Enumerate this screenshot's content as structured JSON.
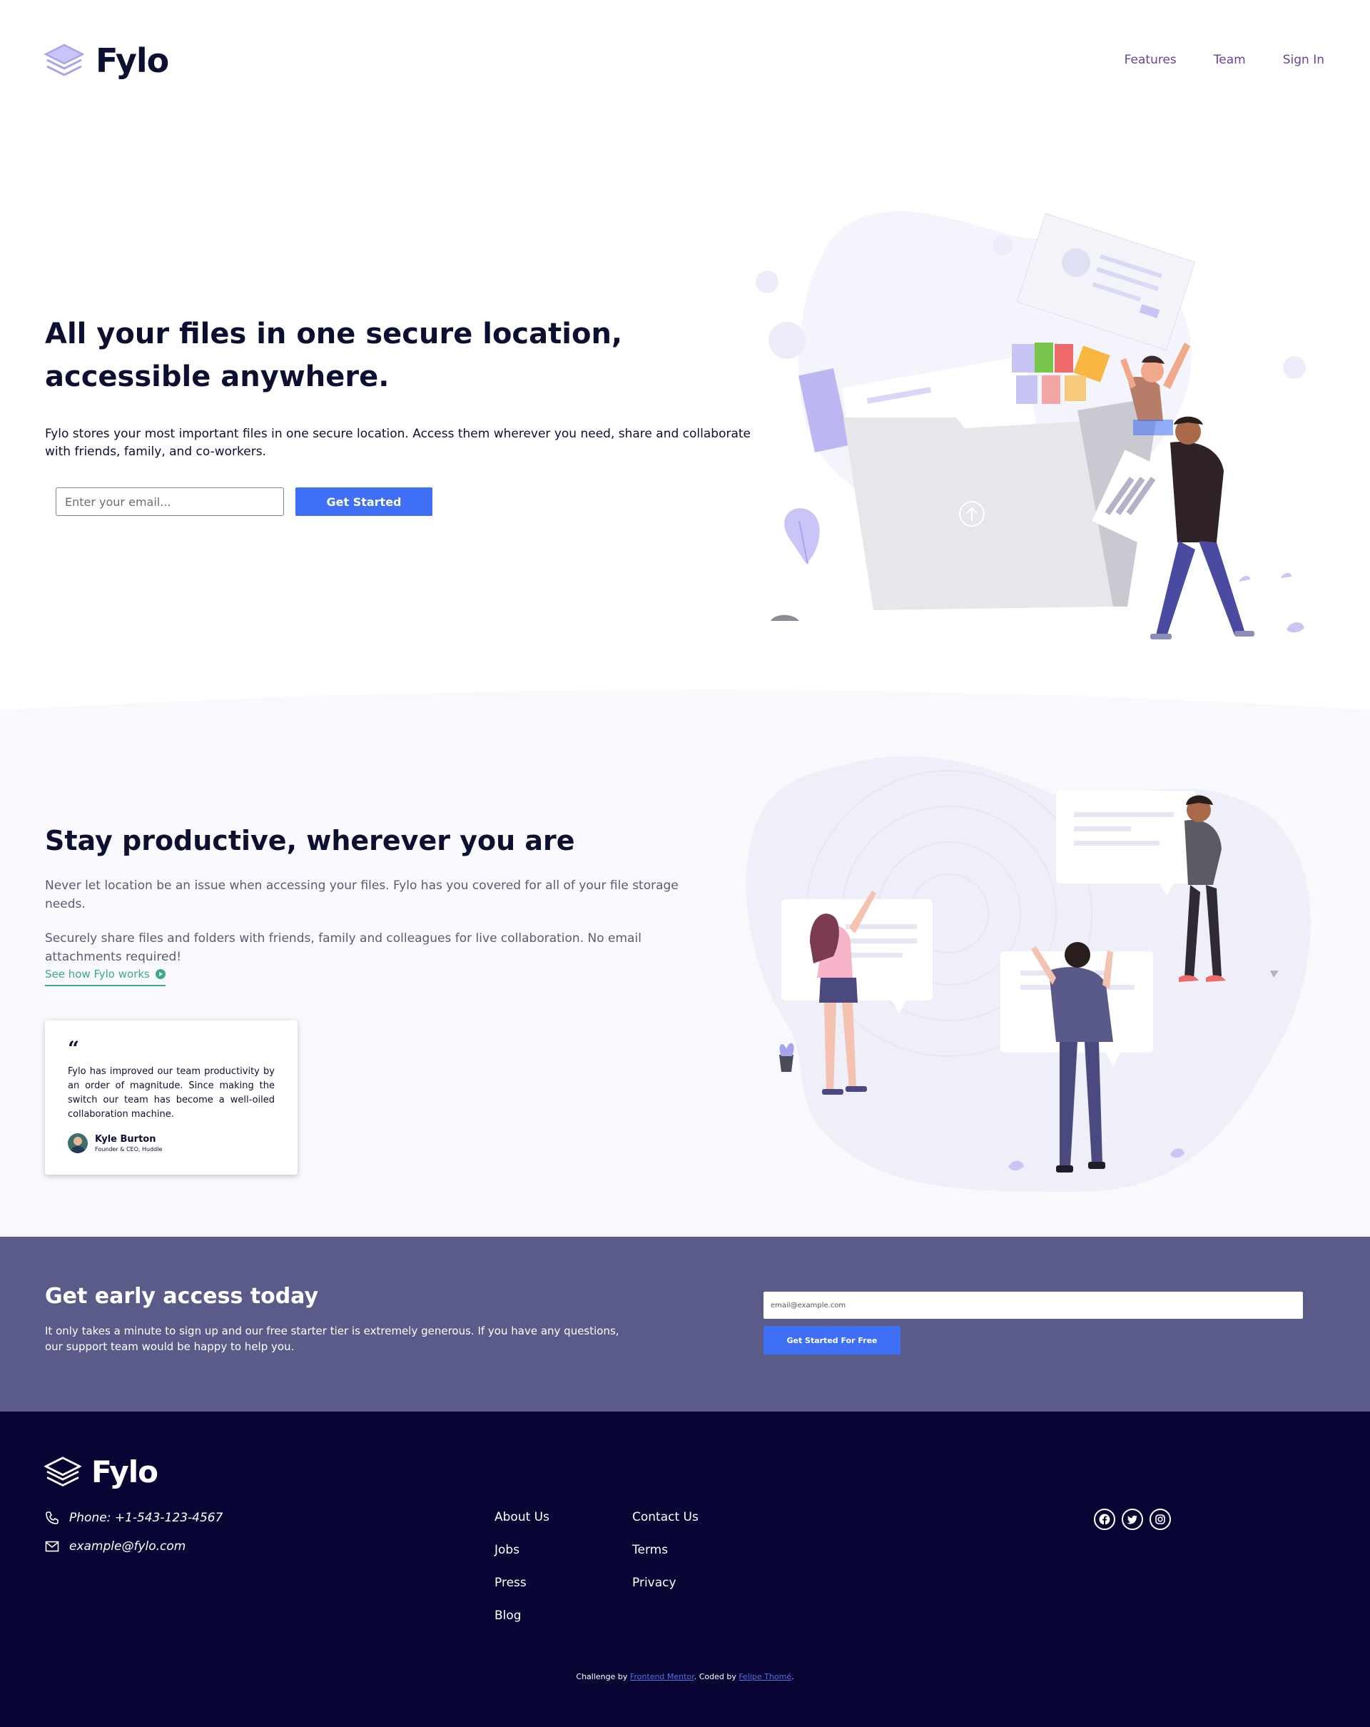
{
  "brand": {
    "name": "Fylo"
  },
  "nav": {
    "links": [
      {
        "label": "Features"
      },
      {
        "label": "Team"
      },
      {
        "label": "Sign In"
      }
    ]
  },
  "hero": {
    "title": "All your files in one secure location, accessible anywhere.",
    "description": "Fylo stores your most important files in one secure location. Access them wherever you need, share and collaborate with friends, family, and co-workers.",
    "email_placeholder": "Enter your email...",
    "cta_label": "Get Started"
  },
  "productive": {
    "title": "Stay productive, wherever you are",
    "paragraph_1": "Never let location be an issue when accessing your files. Fylo has you covered for all of your file storage needs.",
    "paragraph_2": "Securely share files and folders with friends, family and colleagues for live collaboration. No email attachments required!",
    "link_label": "See how Fylo works",
    "testimonial": {
      "quote_mark": "“",
      "text": "Fylo has improved our team productivity by an order of magnitude. Since making the switch our team has become a well-oiled collaboration machine.",
      "name": "Kyle Burton",
      "role": "Founder & CEO, Huddle"
    }
  },
  "early_access": {
    "title": "Get early access today",
    "description": "It only takes a minute to sign up and our free starter tier is extremely generous. If you have any questions, our support team would be happy to help you.",
    "email_placeholder": "email@example.com",
    "cta_label": "Get Started For Free"
  },
  "footer": {
    "phone": "Phone: +1-543-123-4567",
    "email": "example@fylo.com",
    "links_col_1": [
      {
        "label": "About Us"
      },
      {
        "label": "Jobs"
      },
      {
        "label": "Press"
      },
      {
        "label": "Blog"
      }
    ],
    "links_col_2": [
      {
        "label": "Contact Us"
      },
      {
        "label": "Terms"
      },
      {
        "label": "Privacy"
      }
    ],
    "socials": [
      {
        "icon": "facebook-icon"
      },
      {
        "icon": "twitter-icon"
      },
      {
        "icon": "instagram-icon"
      }
    ],
    "credit": {
      "prefix": "Challenge by ",
      "link_1": "Frontend Mentor",
      "middle": ". Coded by ",
      "link_2": "Felipe Thomé",
      "suffix": "."
    }
  },
  "colors": {
    "accent": "#3e6ff4",
    "nav_link": "#6a3f9b",
    "teal": "#3ba992",
    "access_bg": "#5b5b8a",
    "footer_bg": "#080535",
    "heading": "#0c1030"
  }
}
